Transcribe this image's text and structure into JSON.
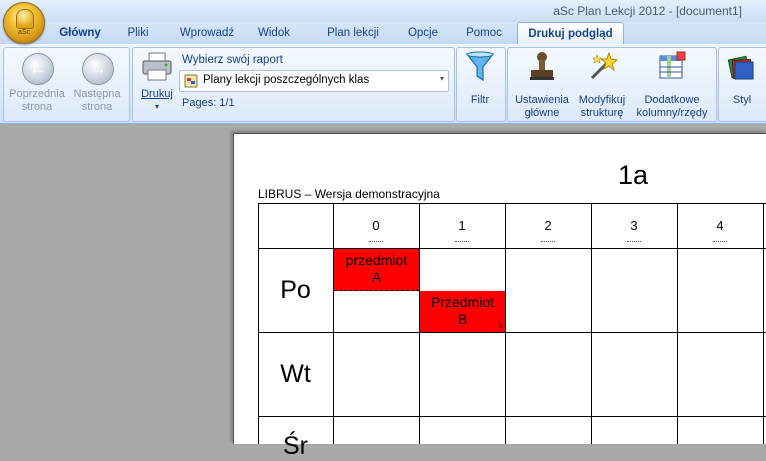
{
  "window": {
    "title": "aSc Plan Lekcji 2012 - [document1]"
  },
  "tabs": [
    {
      "label": "Główny"
    },
    {
      "label": "Pliki"
    },
    {
      "label": "Wprowadź"
    },
    {
      "label": "Widok"
    },
    {
      "label": "Plan lekcji"
    },
    {
      "label": "Opcje"
    },
    {
      "label": "Pomoc"
    },
    {
      "label": "Drukuj podgląd"
    }
  ],
  "active_tab": "Drukuj podgląd",
  "ribbon": {
    "prev_page": {
      "line1": "Poprzednia",
      "line2": "strona"
    },
    "next_page": {
      "line1": "Następna",
      "line2": "strona"
    },
    "print": {
      "label": "Drukuj"
    },
    "report_caption": "Wybierz swój raport",
    "report_selected": "Plany lekcji poszczególnych klas",
    "pages": "Pages: 1/1",
    "filter": {
      "label": "Filtr"
    },
    "settings": {
      "line1": "Ustawienia",
      "line2": "główne"
    },
    "modify": {
      "line1": "Modyfikuj",
      "line2": "strukturę"
    },
    "extra": {
      "line1": "Dodatkowe",
      "line2": "kolumny/rzędy"
    },
    "style": {
      "label": "Styl"
    }
  },
  "document": {
    "class_name": "1a",
    "header_left": "LIBRUS – Wersja demonstracyjna",
    "columns": [
      "0",
      "1",
      "2",
      "3",
      "4"
    ],
    "days": [
      "Po",
      "Wt",
      "Śr"
    ],
    "lessons": [
      {
        "line1": "przedmiot",
        "line2": "A",
        "day": "Po",
        "period": "0"
      },
      {
        "line1": "Przedmiot",
        "line2": "B",
        "day": "Po",
        "period": "1",
        "mark": "K"
      }
    ]
  },
  "colors": {
    "lesson": "#ff0000",
    "accent": "#15428b",
    "workspace": "#a9a9a9"
  }
}
